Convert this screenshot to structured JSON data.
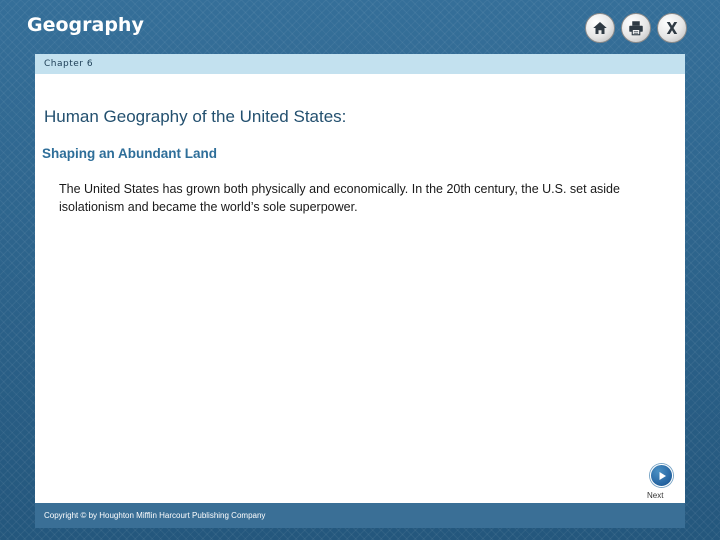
{
  "app": {
    "title": "Geography"
  },
  "toolbar": {
    "home_icon": "home-icon",
    "print_icon": "print-icon",
    "close_icon": "close-icon"
  },
  "chapter": {
    "label": "Chapter 6"
  },
  "main": {
    "title": "Human Geography of the United States:",
    "subtitle": "Shaping an Abundant Land",
    "body": "The United States has grown both physically and economically. In the 20th century, the U.S. set aside isolationism and became the world’s sole superpower."
  },
  "nav": {
    "next_label": "Next",
    "next_icon": "play-arrow-icon"
  },
  "footer": {
    "copyright": "Copyright © by Houghton Mifflin Harcourt Publishing Company"
  },
  "colors": {
    "background": "#2b6a96",
    "chapter_bar": "#c3e1ef",
    "title": "#23506f",
    "subtitle": "#2e6e99",
    "footer": "#3a6f96"
  }
}
